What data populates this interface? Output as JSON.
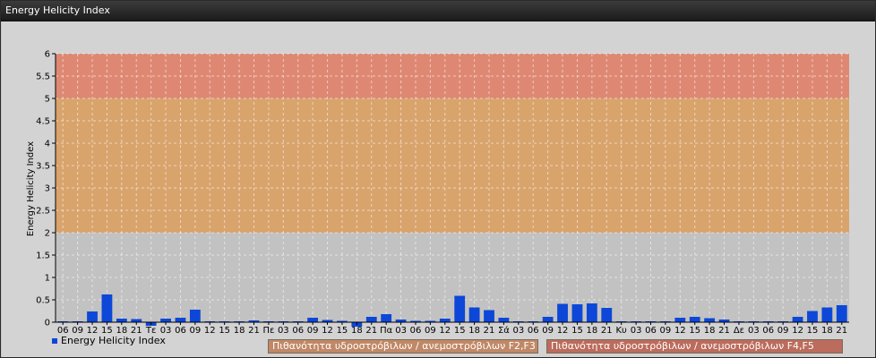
{
  "window": {
    "title": "Energy Helicity Index"
  },
  "legend": {
    "series_label": "Energy Helicity Index"
  },
  "bands": [
    {
      "label": "Πιθανότητα υδροστρόβιλων / ανεμοστρόβιλων F2,F3",
      "from": 2,
      "to": 5,
      "color": "#d9a36c"
    },
    {
      "label": "Πιθανότητα υδροστρόβιλων / ανεμοστρόβιλων F4,F5",
      "from": 5,
      "to": 6,
      "color": "#de8873"
    }
  ],
  "chart_data": {
    "type": "bar",
    "ylabel": "Energy Helicity Index",
    "ylim": [
      0,
      6
    ],
    "yticks": [
      "0",
      "0.5",
      "1",
      "1.5",
      "2",
      "2.5",
      "3",
      "3.5",
      "4",
      "4.5",
      "5",
      "5.5",
      "6"
    ],
    "grid": true,
    "categories": [
      "06",
      "09",
      "12",
      "15",
      "18",
      "21",
      "Τε",
      "03",
      "06",
      "09",
      "12",
      "15",
      "18",
      "21",
      "Πε",
      "03",
      "06",
      "09",
      "12",
      "15",
      "18",
      "21",
      "Πα",
      "03",
      "06",
      "09",
      "12",
      "15",
      "18",
      "21",
      "Σά",
      "03",
      "06",
      "09",
      "12",
      "15",
      "18",
      "21",
      "Κυ",
      "03",
      "06",
      "09",
      "12",
      "15",
      "18",
      "21",
      "Δε",
      "03",
      "06",
      "09",
      "12",
      "15",
      "18",
      "21"
    ],
    "series": [
      {
        "name": "Energy Helicity Index",
        "color": "#0c47d8",
        "values": [
          0.02,
          0.02,
          0.24,
          0.62,
          0.08,
          0.07,
          -0.08,
          0.08,
          0.1,
          0.28,
          0.02,
          0.02,
          0.02,
          0.04,
          0.02,
          0.02,
          0.02,
          0.1,
          0.05,
          0.03,
          -0.1,
          0.12,
          0.18,
          0.06,
          0.03,
          0.03,
          0.08,
          0.59,
          0.33,
          0.27,
          0.1,
          0.02,
          0.02,
          0.12,
          0.41,
          0.4,
          0.42,
          0.32,
          0.02,
          0.02,
          0.02,
          0.02,
          0.1,
          0.12,
          0.09,
          0.06,
          0.02,
          0.02,
          0.02,
          0.02,
          0.12,
          0.25,
          0.33,
          0.38
        ]
      }
    ]
  }
}
